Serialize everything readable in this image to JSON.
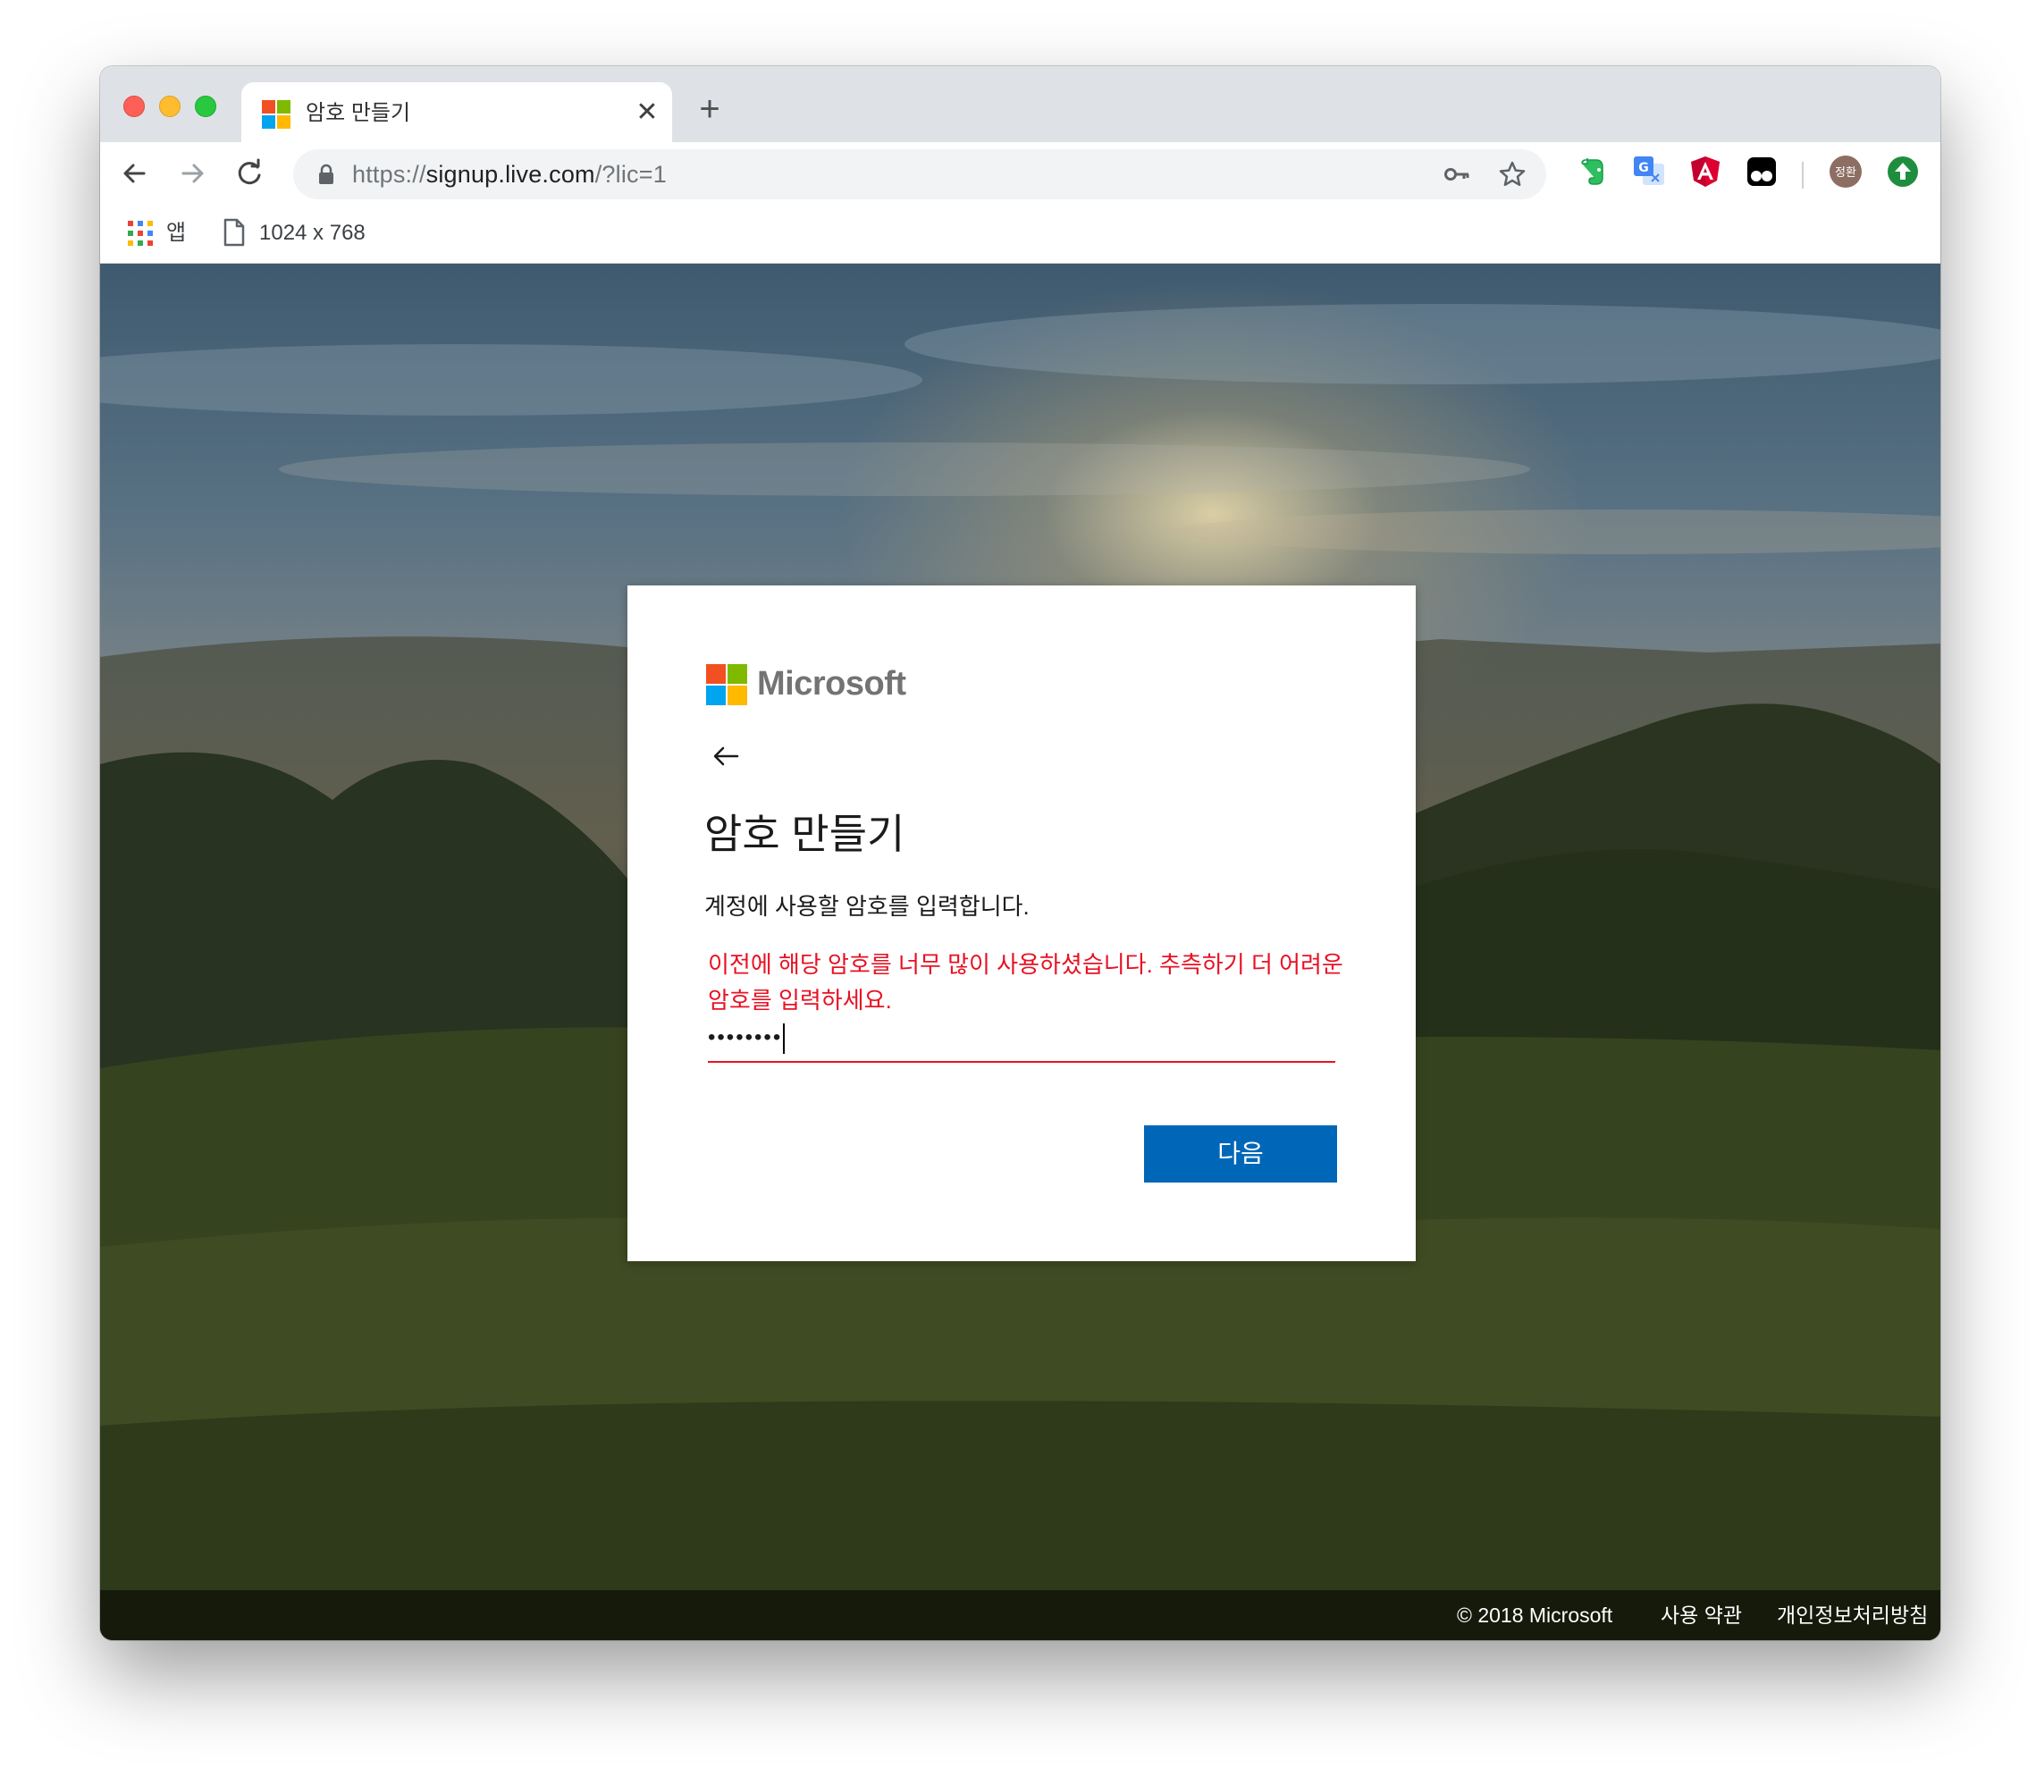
{
  "browser": {
    "tab_title": "암호 만들기",
    "tab_close_glyph": "✕",
    "new_tab_glyph": "+",
    "url_scheme": "https://",
    "url_host": "signup.live.com",
    "url_path": "/?lic=1",
    "profile_initials": "정환",
    "bookmarks": {
      "apps_label": "앱",
      "page_label": "1024 x 768"
    }
  },
  "signup": {
    "brand": "Microsoft",
    "title": "암호 만들기",
    "description": "계정에 사용할 암호를 입력합니다.",
    "error": "이전에 해당 암호를 너무 많이 사용하셨습니다. 추측하기 더 어려운 암호를 입력하세요.",
    "password_masked": "••••••••",
    "next_button": "다음"
  },
  "footer": {
    "copyright": "© 2018 Microsoft",
    "terms": "사용 약관",
    "privacy": "개인정보처리방침"
  },
  "colors": {
    "error": "#e81123",
    "button": "#0067b8",
    "ms_red": "#f25022",
    "ms_green": "#7fba00",
    "ms_blue": "#00a4ef",
    "ms_yellow": "#ffb900"
  }
}
